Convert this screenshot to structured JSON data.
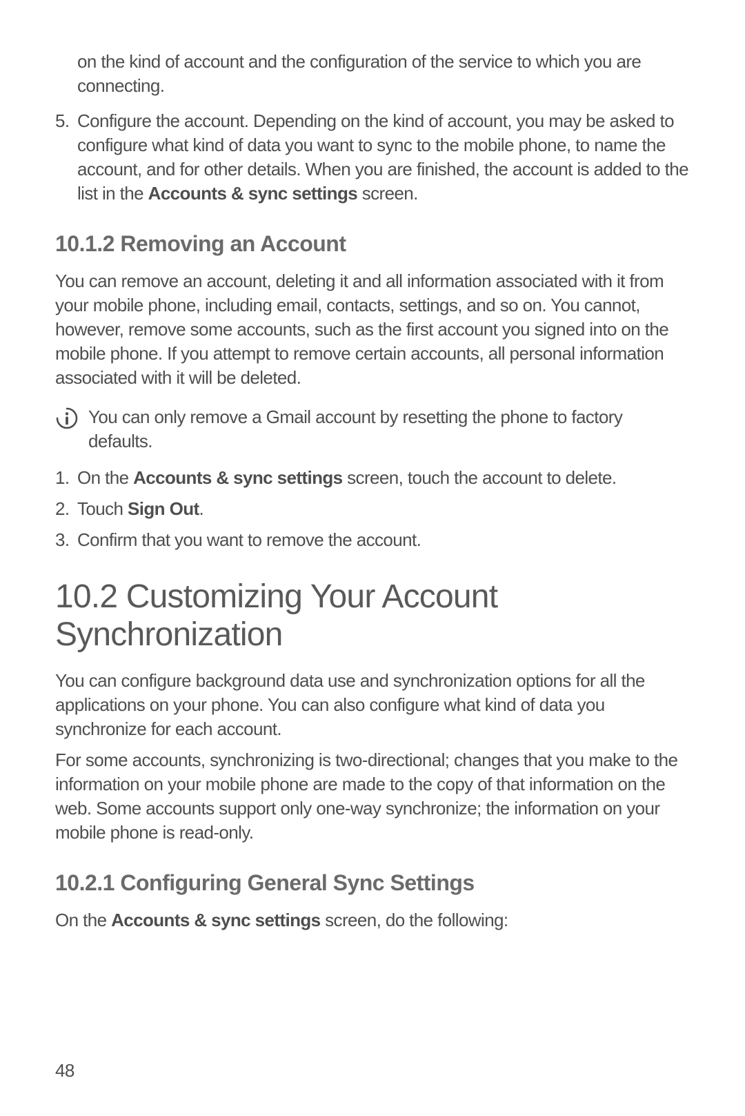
{
  "top_continuation": "on the kind of account and the configuration of the service to which you are connecting.",
  "step5": {
    "num": "5.",
    "text_a": "Configure the account. Depending on the kind of account, you may be asked to configure what kind of data you want to sync to the mobile phone, to name the account, and for other details. When you are finished, the account is added to the list in the ",
    "bold": "Accounts & sync settings",
    "text_b": " screen."
  },
  "h_1012": "10.1.2  Removing an Account",
  "p_remove": "You can remove an account, deleting it and all information associated with it from your mobile phone, including email, contacts, settings, and so on. You cannot, however, remove some accounts, such as the first account you signed into on the mobile phone. If you attempt to remove certain accounts, all  personal information associated with it will be deleted.",
  "callout_text": "You can only remove a Gmail account by resetting the phone to factory defaults.",
  "rm1": {
    "num": "1.",
    "a": "On the ",
    "bold": "Accounts & sync settings",
    "b": " screen, touch the account to delete."
  },
  "rm2": {
    "num": "2.",
    "a": "Touch ",
    "bold": "Sign Out",
    "b": "."
  },
  "rm3": {
    "num": "3.",
    "a": "Confirm that you want to remove the account."
  },
  "h_102": "10.2  Customizing Your Account Synchronization",
  "p_sync1": "You can configure background data use and synchronization options for all the applications on your phone. You can also configure what kind of data you synchronize for each account.",
  "p_sync2": "For some accounts, synchronizing is two-directional; changes that you make to the information on your mobile phone are made to the copy of that information on the web. Some accounts support only one-way synchronize; the information on your mobile phone is read-only.",
  "h_1021": "10.2.1  Configuring General Sync Settings",
  "p_cfg": {
    "a": "On the ",
    "bold": "Accounts & sync settings",
    "b": " screen, do the following:"
  },
  "page_number": "48"
}
